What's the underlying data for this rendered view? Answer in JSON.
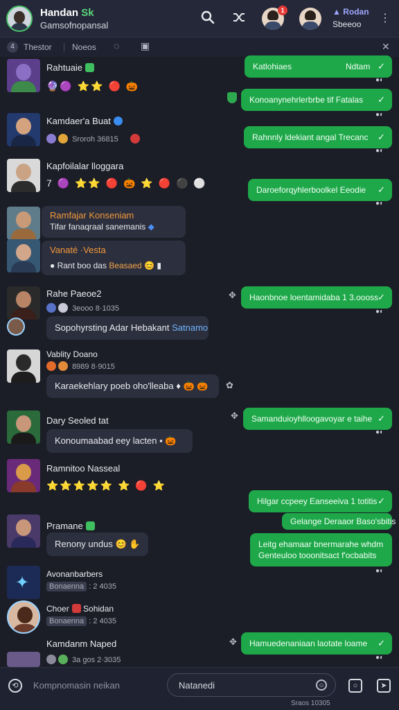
{
  "colors": {
    "background": "#1b1d27",
    "header": "#252838",
    "outgoing": "#1fa84a",
    "incoming": "#2c2f3d",
    "accent_green": "#5ad67c"
  },
  "header": {
    "title_main": "Handan",
    "title_accent": "Sk",
    "subtitle": "Gamsofnopansal",
    "badge": "1",
    "right_title": "Rodan",
    "right_sub": "Sbeeoo",
    "icons": [
      "search-icon",
      "shuffle-icon",
      "more-vert-icon"
    ]
  },
  "subbar": {
    "count": "4",
    "tab1": "Thestor",
    "tab2": "Noeos"
  },
  "messages": [
    {
      "name": "Rahtuaie",
      "emoji": "🔮🟣 ⭐⭐ 🔴 🎃"
    },
    {
      "name": "Kamdaer'a Buat",
      "meta": "Sroroh 36815"
    },
    {
      "name": "Kapfoilalar lloggara",
      "emoji": "7 🟣 ⭐⭐ 🔴 🎃 ⭐ 🔴 ⚫ ⚪"
    },
    {
      "name": "Ramfajar Konseniam",
      "bubble": "Tifar fanaqraal sanemanis"
    },
    {
      "name": "Vanaté ·Vesta",
      "bubble_a": "Rant boo das",
      "bubble_b": "Beasaed"
    },
    {
      "name": "Rahe Paeoe2",
      "meta": "3eooo 8·1035",
      "bubble_a": "Sopohyrsting Adar Hebakant",
      "bubble_b": "Satnamo"
    },
    {
      "name": "Vablity Doano",
      "meta": "8989 8·9015",
      "bubble": "Karaekehlary poeb oho'lleaba"
    },
    {
      "name": "Dary Seoled tat",
      "bubble": "Konoumaabad eey lacten"
    },
    {
      "name": "Ramnitoo Nasseal",
      "emoji": "⭐⭐⭐⭐⭐ ⭐ 🔴 ⭐"
    },
    {
      "name": "Pramane",
      "bubble": "Renony undus"
    },
    {
      "name": "Avonanbarbers",
      "meta_tag": "Bonaenna",
      "meta": ": 2 4035"
    },
    {
      "name": "Choer",
      "name2": "Sohidan",
      "meta_tag": "Bonaenna",
      "meta": ": 2 4035"
    },
    {
      "name": "Kamdanm Naped",
      "meta": "3a gos 2·3035"
    }
  ],
  "outgoing": [
    {
      "text": "Katlohiaes",
      "right": "Ndtam"
    },
    {
      "text": "Konoanynehrlerbrbe tif Fatalas"
    },
    {
      "text": "Rahnnly ldekiant angal Trecanc"
    },
    {
      "text": "Daroeforqyhlerboolkel Eeodie"
    },
    {
      "text": "Haonbnoe loentamidaba 1 3.oooss"
    },
    {
      "text": "Samanduioyhlloogavoyar e taihe"
    },
    {
      "text": "Hilgar ccpeey Eanseeiva 1 totitis"
    },
    {
      "text": "Gelange Deraaor Baso'sbitis"
    },
    {
      "text1": "Leitg ehamaar bnermarahe whdm",
      "text2": "Genteuloo tooonitsact f'ocbabits"
    },
    {
      "text": "Hamuedenaniaan laotate loame"
    }
  ],
  "input": {
    "placeholder": "Kompnomasin neikan",
    "field": "Natanedi",
    "footer": "Sraos 10305"
  }
}
